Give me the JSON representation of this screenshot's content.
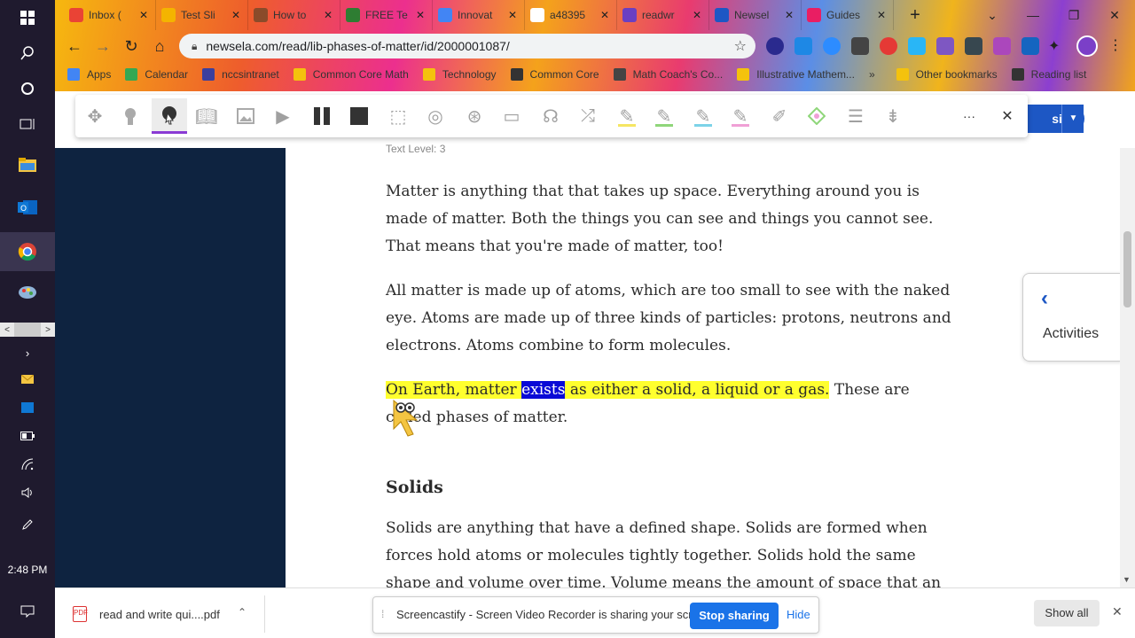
{
  "browser": {
    "tabs": [
      {
        "label": "Inbox (",
        "favicon_color": "#ea4335"
      },
      {
        "label": "Test Sli",
        "favicon_color": "#f4b400"
      },
      {
        "label": "How to",
        "favicon_color": "#8a4b2a"
      },
      {
        "label": "FREE Te",
        "favicon_color": "#2e7d32"
      },
      {
        "label": "Innovat",
        "favicon_color": "#4285f4"
      },
      {
        "label": "a48395",
        "favicon_color": "#ffffff"
      },
      {
        "label": "readwr",
        "favicon_color": "#6a3fc2"
      },
      {
        "label": "Newsel",
        "favicon_color": "#1d57c4"
      },
      {
        "label": "Guides",
        "favicon_color": "#e91e63"
      }
    ],
    "new_tab": "+",
    "url": "newsela.com/read/lib-phases-of-matter/id/2000001087/",
    "bookmarks": [
      {
        "label": "Apps",
        "color": "#4285f4"
      },
      {
        "label": "Calendar",
        "color": "#34a853"
      },
      {
        "label": "nccsintranet",
        "color": "#3b3f9e"
      },
      {
        "label": "Common Core Math",
        "color": "#f4c20d"
      },
      {
        "label": "Technology",
        "color": "#f4c20d"
      },
      {
        "label": "Common Core",
        "color": "#333333"
      },
      {
        "label": "Math Coach's Co...",
        "color": "#444444"
      },
      {
        "label": "Illustrative Mathem...",
        "color": "#f4c20d"
      },
      {
        "label": "»",
        "color": "#333333"
      },
      {
        "label": "Other bookmarks",
        "color": "#f4c20d"
      },
      {
        "label": "Reading list",
        "color": "#333333"
      }
    ]
  },
  "taskbar": {
    "time": "2:48 PM"
  },
  "page": {
    "text_level": "Text Level: 3",
    "assign_label": "sign",
    "paragraphs": [
      "Matter is anything that that takes up space. Everything around you is made of matter. Both the things you can see and things you cannot see. That means that you're made of matter, too!",
      "All matter is made up of atoms, which are too small to see with the naked eye. Atoms are made up of three kinds of particles: protons, neutrons and electrons. Atoms combine to form molecules."
    ],
    "highlight_para": {
      "hl_before": "On Earth, matter ",
      "selected_word": "exists",
      "hl_after": " as either a solid, a liquid or a gas.",
      "plain": " These are called phases of matter."
    },
    "heading_solids": "Solids",
    "solids_para": "Solids are anything that have a defined shape. Solids are formed when forces hold atoms or molecules tightly together. Solids hold the same shape and volume over time. Volume means the amount of space that an object takes up.",
    "activities_label": "Activities"
  },
  "downloads": {
    "file": "read and write qui....pdf",
    "share_message": "Screencastify - Screen Video Recorder is sharing your screen.",
    "stop_sharing": "Stop sharing",
    "hide": "Hide",
    "show_all": "Show all"
  },
  "colors": {
    "accent": "#1d57c4",
    "highlight_yellow": "#ffff2e",
    "selection_blue": "#0a0ad6",
    "toolbar_active_underline": "#8a3bd4"
  }
}
